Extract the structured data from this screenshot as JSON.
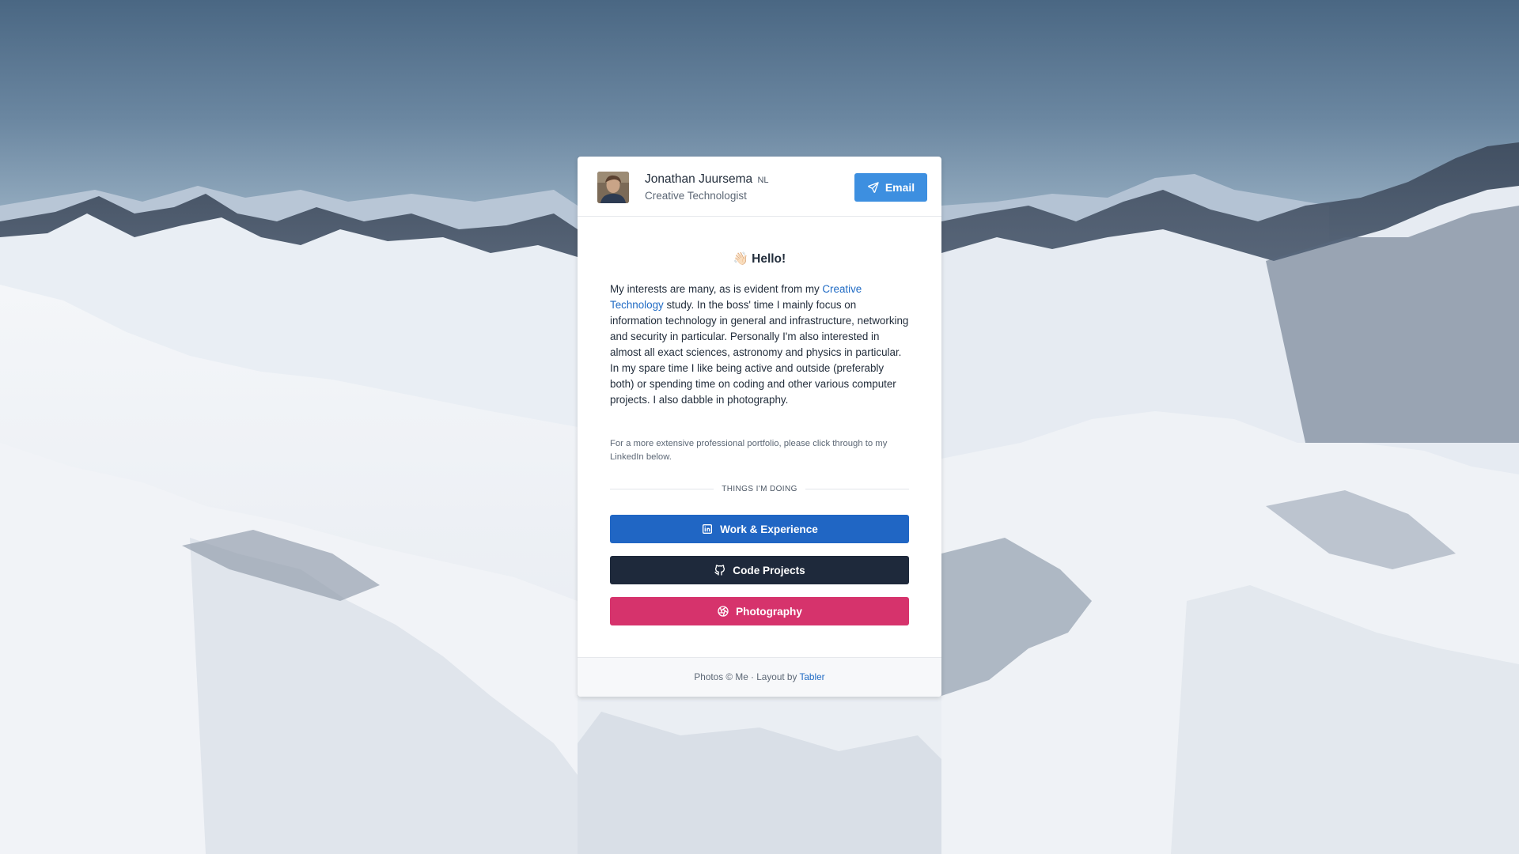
{
  "profile": {
    "name": "Jonathan Juursema",
    "country": "NL",
    "role": "Creative Technologist",
    "email_label": "Email"
  },
  "intro": {
    "wave_emoji": "👋🏻",
    "greeting": "Hello!",
    "bio_start": "My interests are many, as is evident from my ",
    "bio_link": "Creative Technology",
    "bio_end": " study. In the boss' time I mainly focus on information technology in general and infrastructure, networking and security in particular. Personally I'm also interested in almost all exact sciences, astronomy and physics in particular. In my spare time I like being active and outside (preferably both) or spending time on coding and other various computer projects. I also dabble in photography.",
    "note": "For a more extensive professional portfolio, please click through to my LinkedIn below."
  },
  "section": {
    "divider_label": "THINGS I'M DOING"
  },
  "links": {
    "work": {
      "label": "Work & Experience",
      "icon": "linkedin-icon",
      "color": "#2066c4"
    },
    "code": {
      "label": "Code Projects",
      "icon": "github-icon",
      "color": "#1e293b"
    },
    "photo": {
      "label": "Photography",
      "icon": "aperture-icon",
      "color": "#d6336c"
    }
  },
  "footer": {
    "text": "Photos © Me · Layout by ",
    "link": "Tabler"
  },
  "colors": {
    "accent": "#3d8fe0",
    "link": "#206bc4"
  }
}
